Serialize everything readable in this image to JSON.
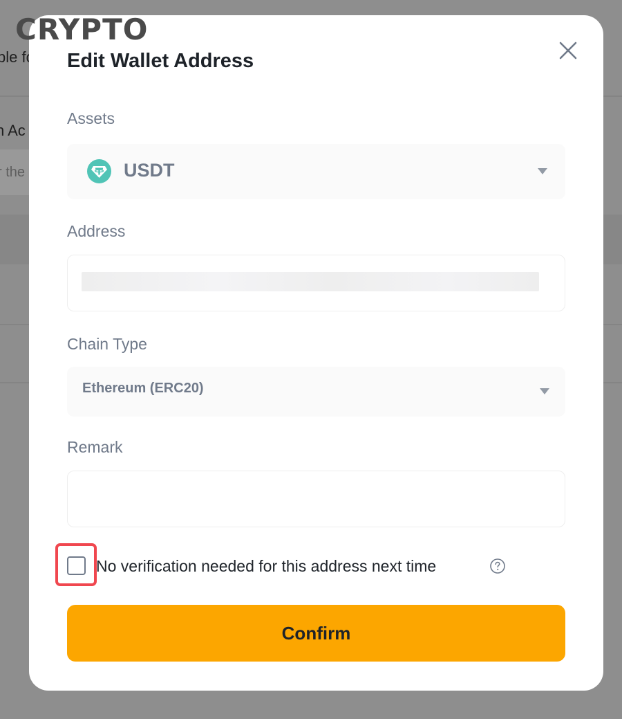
{
  "logo": {
    "text": "CRYPTO"
  },
  "background": {
    "fragment_1": "ble fo",
    "fragment_2": "h Ac",
    "fragment_3": "r the"
  },
  "modal": {
    "title": "Edit Wallet Address",
    "close_icon": "close-icon",
    "assets": {
      "label": "Assets",
      "value": "USDT",
      "icon": "tether-icon",
      "icon_color": "#50c4b6"
    },
    "address": {
      "label": "Address",
      "value": ""
    },
    "chain_type": {
      "label": "Chain Type",
      "value": "Ethereum (ERC20)"
    },
    "remark": {
      "label": "Remark",
      "value": ""
    },
    "no_verification": {
      "label": "No verification needed for this address next time",
      "checked": false,
      "help_icon": "question-circle-icon"
    },
    "confirm_label": "Confirm"
  },
  "colors": {
    "accent": "#fca600",
    "highlight": "#f0474f",
    "text_primary": "#1e2329",
    "text_secondary": "#707a8a"
  }
}
